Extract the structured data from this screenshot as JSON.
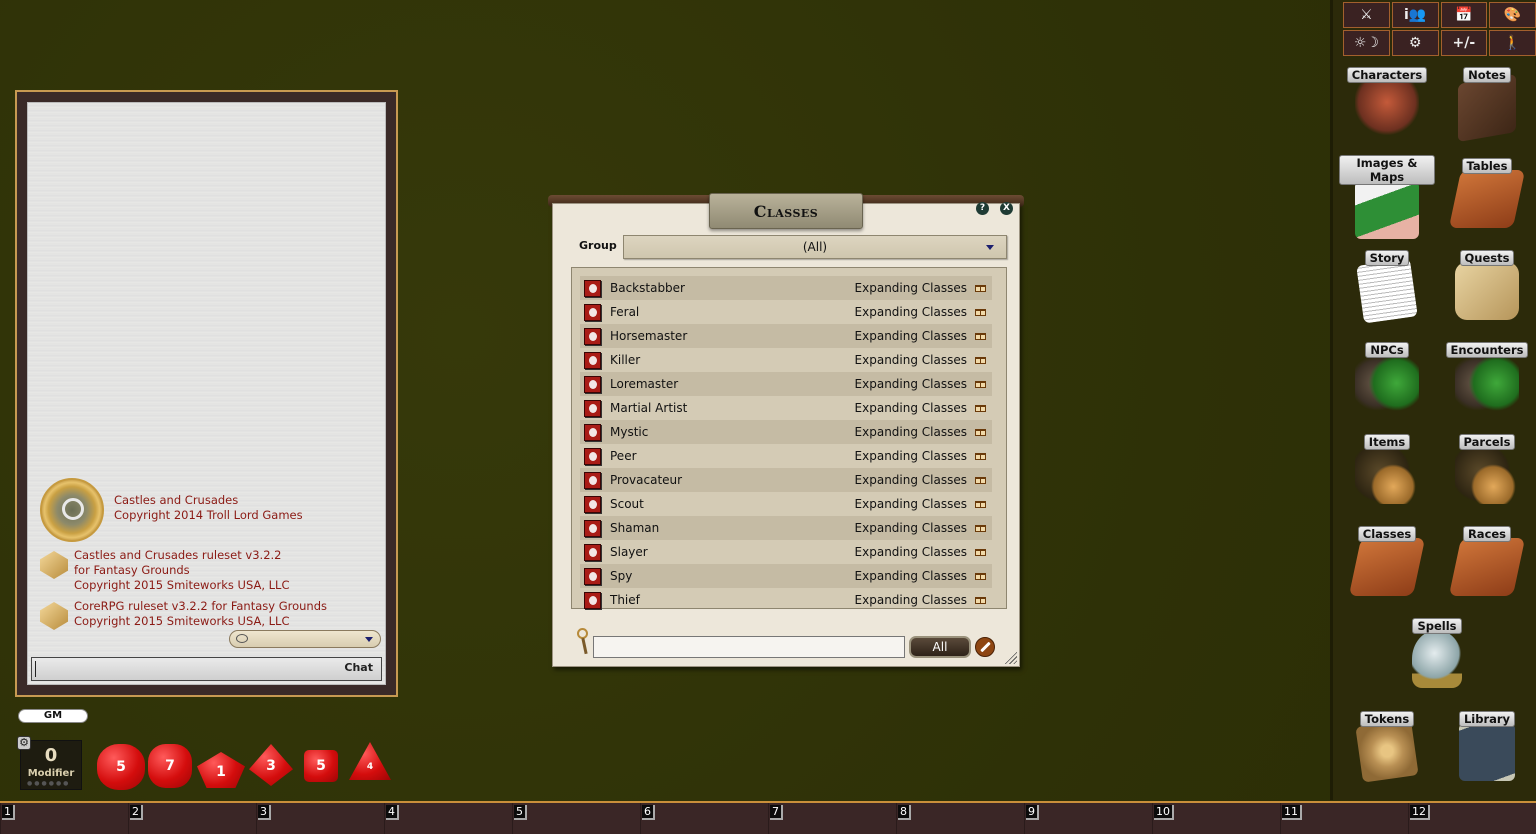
{
  "chat": {
    "credits": [
      {
        "line1": "Castles and Crusades",
        "line2": "Copyright 2014 Troll Lord Games"
      },
      {
        "line1": "Castles and Crusades ruleset v3.2.2",
        "line2": "for Fantasy Grounds",
        "line3": "Copyright 2015 Smiteworks USA, LLC"
      },
      {
        "line1": "CoreRPG ruleset v3.2.2 for Fantasy Grounds",
        "line2": "Copyright 2015 Smiteworks USA, LLC"
      }
    ],
    "mode_value": "",
    "entry_value": "",
    "send_label": "Chat"
  },
  "identity": {
    "label": "GM"
  },
  "modifier": {
    "value": "0",
    "label": "Modifier",
    "gear_icon": "gear-icon"
  },
  "dice": [
    {
      "name": "d20",
      "face": "5"
    },
    {
      "name": "d12",
      "face": "7"
    },
    {
      "name": "d10",
      "face": "1"
    },
    {
      "name": "d8",
      "face": "3"
    },
    {
      "name": "d6",
      "face": "5"
    },
    {
      "name": "d4",
      "face": "4"
    }
  ],
  "hotbar": {
    "slots": [
      "1",
      "2",
      "3",
      "4",
      "5",
      "6",
      "7",
      "8",
      "9",
      "10",
      "11",
      "12"
    ]
  },
  "toolbar": {
    "buttons": [
      {
        "icon": "combat-tracker-icon",
        "glyph": "⚔"
      },
      {
        "icon": "party-sheet-icon",
        "glyph": "i👥"
      },
      {
        "icon": "calendar-icon",
        "glyph": "📅"
      },
      {
        "icon": "color-palette-icon",
        "glyph": "🎨"
      },
      {
        "icon": "lighting-icon",
        "glyph": "☼☽"
      },
      {
        "icon": "options-gear-icon",
        "glyph": "⚙"
      },
      {
        "icon": "modifiers-icon",
        "glyph": "+/-"
      },
      {
        "icon": "effects-icon",
        "glyph": "🚶"
      }
    ]
  },
  "sidebar": {
    "launchers": [
      {
        "label": "Characters",
        "icon": "characters-icon"
      },
      {
        "label": "Notes",
        "icon": "notes-icon"
      },
      {
        "label": "Images & Maps",
        "icon": "images-maps-icon"
      },
      {
        "label": "Tables",
        "icon": "tables-icon"
      },
      {
        "label": "Story",
        "icon": "story-icon"
      },
      {
        "label": "Quests",
        "icon": "quests-icon"
      },
      {
        "label": "NPCs",
        "icon": "npcs-icon"
      },
      {
        "label": "Encounters",
        "icon": "encounters-icon"
      },
      {
        "label": "Items",
        "icon": "items-icon"
      },
      {
        "label": "Parcels",
        "icon": "parcels-icon"
      },
      {
        "label": "Classes",
        "icon": "classes-icon"
      },
      {
        "label": "Races",
        "icon": "races-icon"
      },
      {
        "label": "Spells",
        "icon": "spells-icon"
      },
      {
        "label": "Tokens",
        "icon": "tokens-icon"
      },
      {
        "label": "Library",
        "icon": "library-icon"
      }
    ]
  },
  "classes_window": {
    "title": "Classes",
    "help_label": "?",
    "close_label": "X",
    "group_label": "Group",
    "group_value": "(All)",
    "rows": [
      {
        "name": "Backstabber",
        "source": "Expanding Classes"
      },
      {
        "name": "Feral",
        "source": "Expanding Classes"
      },
      {
        "name": "Horsemaster",
        "source": "Expanding Classes"
      },
      {
        "name": "Killer",
        "source": "Expanding Classes"
      },
      {
        "name": "Loremaster",
        "source": "Expanding Classes"
      },
      {
        "name": "Martial Artist",
        "source": "Expanding Classes"
      },
      {
        "name": "Mystic",
        "source": "Expanding Classes"
      },
      {
        "name": "Peer",
        "source": "Expanding Classes"
      },
      {
        "name": "Provacateur",
        "source": "Expanding Classes"
      },
      {
        "name": "Scout",
        "source": "Expanding Classes"
      },
      {
        "name": "Shaman",
        "source": "Expanding Classes"
      },
      {
        "name": "Slayer",
        "source": "Expanding Classes"
      },
      {
        "name": "Spy",
        "source": "Expanding Classes"
      },
      {
        "name": "Thief",
        "source": "Expanding Classes"
      }
    ],
    "search_value": "",
    "filter_label": "All"
  }
}
